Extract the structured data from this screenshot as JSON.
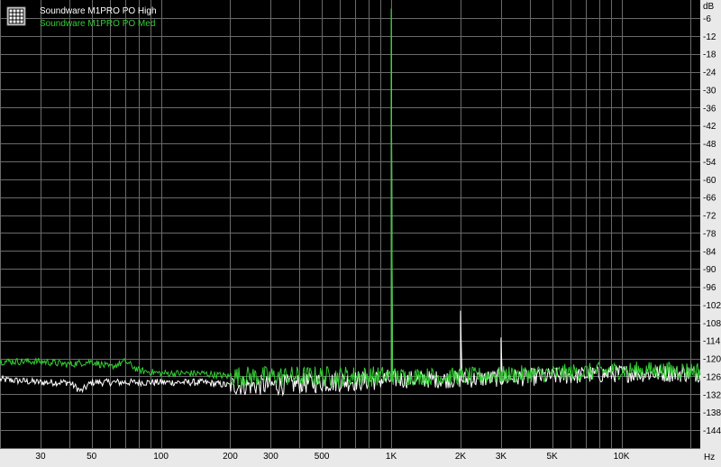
{
  "chart_data": {
    "type": "line",
    "title": "",
    "xlabel": "",
    "ylabel": "",
    "x_unit": "Hz",
    "y_unit": "dB",
    "xscale": "log",
    "xlim": [
      20,
      22000
    ],
    "ylim": [
      -150,
      0
    ],
    "grid": true,
    "legend_position": "top-left",
    "x_ticks": [
      {
        "value": 30,
        "label": "30"
      },
      {
        "value": 50,
        "label": "50"
      },
      {
        "value": 100,
        "label": "100"
      },
      {
        "value": 200,
        "label": "200"
      },
      {
        "value": 300,
        "label": "300"
      },
      {
        "value": 500,
        "label": "500"
      },
      {
        "value": 1000,
        "label": "1K"
      },
      {
        "value": 2000,
        "label": "2K"
      },
      {
        "value": 3000,
        "label": "3K"
      },
      {
        "value": 5000,
        "label": "5K"
      },
      {
        "value": 10000,
        "label": "10K"
      }
    ],
    "y_ticks": [
      -6,
      -12,
      -18,
      -24,
      -30,
      -36,
      -42,
      -48,
      -54,
      -60,
      -66,
      -72,
      -78,
      -84,
      -90,
      -96,
      -102,
      -108,
      -114,
      -120,
      -126,
      -132,
      -138,
      -144
    ],
    "series": [
      {
        "name": "Soundware M1PRO PO High",
        "color": "#ffffff",
        "baseline": [
          [
            20,
            -127
          ],
          [
            30,
            -128
          ],
          [
            40,
            -128
          ],
          [
            45,
            -131
          ],
          [
            50,
            -128
          ],
          [
            70,
            -128
          ],
          [
            100,
            -128
          ],
          [
            150,
            -128
          ],
          [
            200,
            -129
          ],
          [
            300,
            -129
          ],
          [
            500,
            -128
          ],
          [
            1000,
            -127
          ],
          [
            2000,
            -127
          ],
          [
            5000,
            -126
          ],
          [
            10000,
            -125
          ],
          [
            20000,
            -125
          ]
        ],
        "peaks": [
          [
            1000,
            -3
          ],
          [
            2000,
            -104
          ],
          [
            3000,
            -113
          ]
        ]
      },
      {
        "name": "Soundware M1PRO PO Med",
        "color": "#33cc33",
        "baseline": [
          [
            20,
            -121
          ],
          [
            30,
            -121
          ],
          [
            40,
            -122
          ],
          [
            50,
            -121
          ],
          [
            60,
            -123
          ],
          [
            70,
            -121
          ],
          [
            80,
            -124
          ],
          [
            100,
            -125
          ],
          [
            150,
            -125
          ],
          [
            200,
            -126
          ],
          [
            300,
            -126
          ],
          [
            500,
            -126
          ],
          [
            1000,
            -126
          ],
          [
            2000,
            -126
          ],
          [
            5000,
            -125
          ],
          [
            10000,
            -124
          ],
          [
            20000,
            -124
          ]
        ],
        "peaks": [
          [
            1000,
            -3
          ],
          [
            2000,
            -124
          ],
          [
            3000,
            -124
          ]
        ]
      }
    ]
  },
  "legend_icon": "graph-icon"
}
